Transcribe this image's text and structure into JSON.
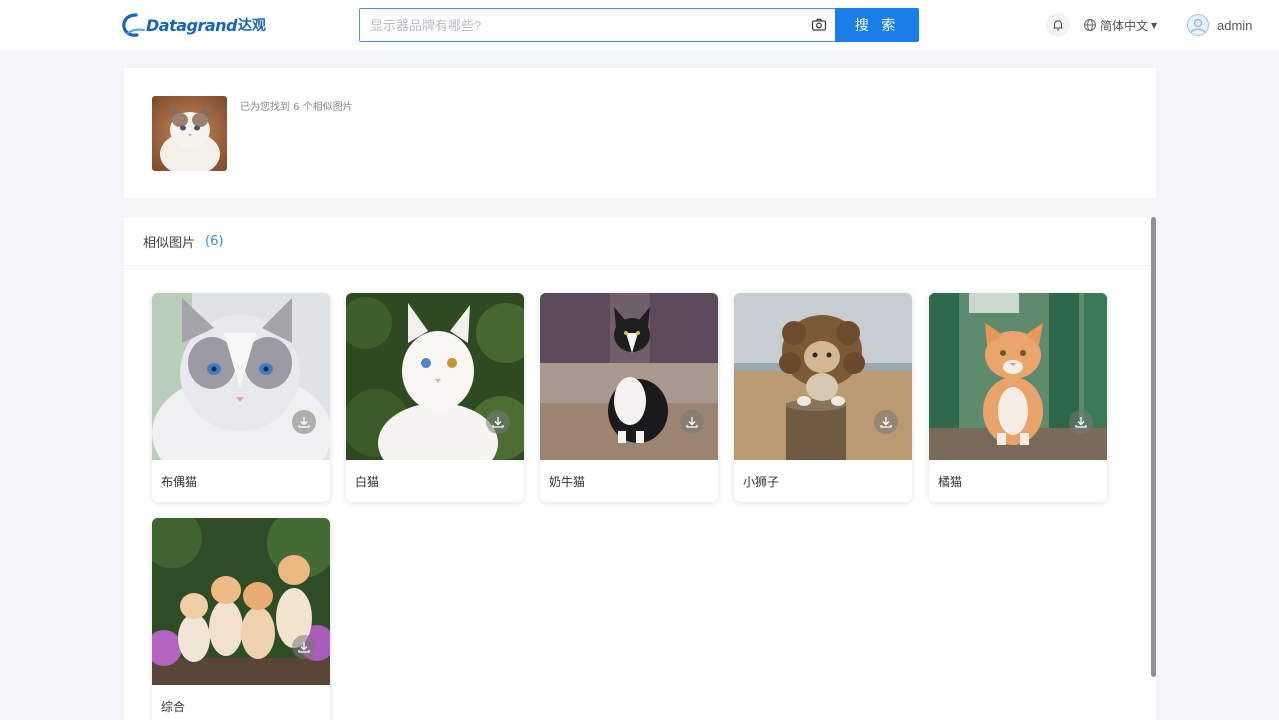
{
  "header": {
    "logo_text": "Datagrand",
    "logo_cn": "达观",
    "search_placeholder": "显示器品牌有哪些?",
    "search_button": "搜 索",
    "language": "简体中文",
    "username": "admin"
  },
  "query": {
    "found_text": "已为您找到 6 个相似图片"
  },
  "results": {
    "title": "相似图片",
    "count": "(6)",
    "items": [
      {
        "label": "布偶猫"
      },
      {
        "label": "白猫"
      },
      {
        "label": "奶牛猫"
      },
      {
        "label": "小狮子"
      },
      {
        "label": "橘猫"
      },
      {
        "label": "综合"
      }
    ]
  },
  "icons": {
    "camera": "camera-icon",
    "bell": "bell-icon",
    "globe": "globe-icon",
    "download": "download-icon"
  },
  "colors": {
    "accent": "#1a7ee8",
    "count": "#3b8bd9"
  }
}
